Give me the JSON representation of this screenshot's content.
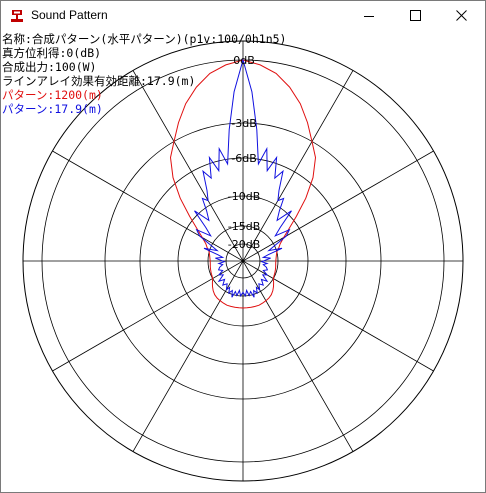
{
  "window": {
    "title": "Sound Pattern",
    "controls": [
      "minimize",
      "maximize",
      "close"
    ]
  },
  "info": {
    "name": "名称:合成パターン(水平パターン)(p1v:100/0h1n5)",
    "gain": "真方位利得:0(dB)",
    "power": "合成出力:100(W)",
    "distance": "ラインアレイ効果有効距離:17.9(m)",
    "pattern1": "パターン:1200(m)",
    "pattern2": "パターン:17.9(m)"
  },
  "colors": {
    "pattern1": "#e01010",
    "pattern2": "#1010e0",
    "grid": "#000000",
    "close_icon": "#c00000"
  },
  "chart_data": {
    "type": "polar",
    "radial_labels": [
      "0dB",
      "-3dB",
      "-6dB",
      "-10dB",
      "-15dB",
      "-20dB"
    ],
    "radial_levels_db": [
      0,
      -3,
      -6,
      -10,
      -15,
      -20
    ],
    "angular_grid_step_deg": 30,
    "series": [
      {
        "name": "パターン:1200(m)",
        "angles_deg": [
          0,
          5,
          10,
          15,
          20,
          25,
          30,
          35,
          40,
          45,
          50,
          55,
          60,
          65,
          70,
          75,
          80,
          85,
          90,
          95,
          100,
          105,
          110,
          115,
          120,
          125,
          130,
          135,
          140,
          145,
          150,
          155,
          160,
          165,
          170,
          175,
          180
        ],
        "values_db": [
          0,
          -0.2,
          -0.5,
          -1,
          -1.6,
          -2.3,
          -3,
          -4,
          -5.5,
          -7.5,
          -9.5,
          -11.5,
          -13,
          -14,
          -14.5,
          -15,
          -15.3,
          -15.5,
          -15.6,
          -15.6,
          -15.5,
          -15.4,
          -15.3,
          -15.2,
          -15,
          -14.6,
          -14.2,
          -13.8,
          -13.5,
          -13.3,
          -13.2,
          -13.1,
          -13,
          -13,
          -13,
          -13,
          -13
        ]
      },
      {
        "name": "パターン:17.9(m)",
        "angles_deg": [
          0,
          3,
          6,
          9,
          12,
          15,
          18,
          21,
          24,
          27,
          30,
          33,
          36,
          40,
          44,
          48,
          52,
          56,
          60,
          64,
          68,
          72,
          76,
          80,
          84,
          88,
          92,
          96,
          100,
          105,
          110,
          115,
          120,
          125,
          130,
          135,
          140,
          145,
          150,
          153,
          156,
          160,
          163,
          166,
          170,
          173,
          176,
          180
        ],
        "values_db": [
          0,
          -1.5,
          -3.5,
          -6.5,
          -5,
          -7,
          -5.5,
          -7.5,
          -6.5,
          -8.5,
          -9.5,
          -9,
          -10.5,
          -12,
          -9.5,
          -12.5,
          -14,
          -11.5,
          -12.5,
          -15,
          -17,
          -14,
          -17.5,
          -19,
          -17,
          -18.5,
          -19.5,
          -18,
          -19,
          -18,
          -17.5,
          -18.5,
          -17,
          -18,
          -16,
          -17.5,
          -16,
          -17,
          -15.5,
          -16.5,
          -15,
          -16,
          -14.5,
          -16,
          -15,
          -16.5,
          -15,
          -16
        ]
      }
    ]
  }
}
